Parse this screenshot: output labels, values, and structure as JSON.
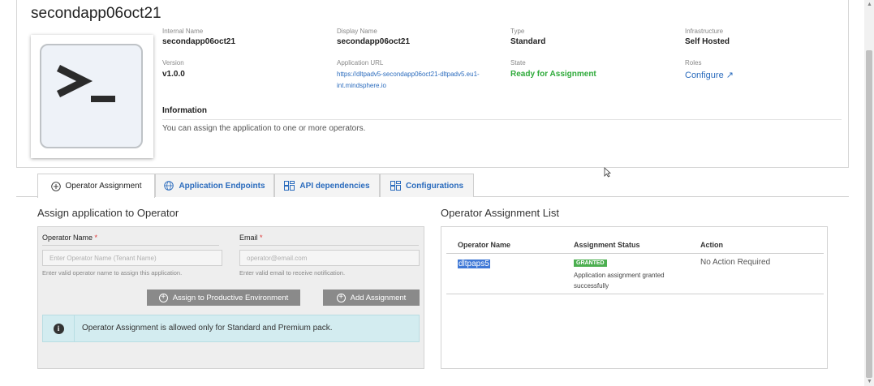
{
  "app": {
    "title": "secondapp06oct21",
    "fields": {
      "internal_name": {
        "label": "Internal Name",
        "value": "secondapp06oct21"
      },
      "display_name": {
        "label": "Display Name",
        "value": "secondapp06oct21"
      },
      "type": {
        "label": "Type",
        "value": "Standard"
      },
      "infrastructure": {
        "label": "Infrastructure",
        "value": "Self Hosted"
      },
      "version": {
        "label": "Version",
        "value": "v1.0.0"
      },
      "app_url": {
        "label": "Application URL",
        "value": "https://dltpadv5-secondapp06oct21-dltpadv5.eu1-int.mindsphere.io"
      },
      "state": {
        "label": "State",
        "value": "Ready for Assignment"
      },
      "roles": {
        "label": "Roles",
        "value": "Configure ↗"
      }
    },
    "information": {
      "label": "Information",
      "text": "You can assign the application to one or more operators."
    },
    "icon": "terminal-prompt-icon"
  },
  "tabs": [
    {
      "label": "Operator Assignment",
      "icon": "plus-circle-icon",
      "active": true
    },
    {
      "label": "Application Endpoints",
      "icon": "globe-icon",
      "active": false
    },
    {
      "label": "API dependencies",
      "icon": "grid-icon",
      "active": false
    },
    {
      "label": "Configurations",
      "icon": "grid-icon",
      "active": false
    }
  ],
  "assign_form": {
    "title": "Assign application to Operator",
    "operator_name": {
      "label": "Operator Name",
      "required": "*",
      "placeholder": "Enter Operator Name (Tenant Name)",
      "hint": "Enter valid operator name to assign this application."
    },
    "email": {
      "label": "Email",
      "required": "*",
      "placeholder": "operator@email.com",
      "hint": "Enter valid email to receive notification."
    },
    "btn_productive": "Assign to Productive Environment",
    "btn_add": "Add Assignment",
    "alert": "Operator Assignment is allowed only for Standard and Premium pack."
  },
  "assignment_list": {
    "title": "Operator Assignment List",
    "columns": [
      "Operator Name",
      "Assignment Status",
      "Action"
    ],
    "rows": [
      {
        "operator": "dltpaps5",
        "badge": "GRANTED",
        "status": "Application assignment granted successfully",
        "action": "No Action Required"
      }
    ]
  },
  "colors": {
    "accent": "#2a6bbd",
    "success": "#2eaa3a",
    "badge": "#4caf50",
    "info_bg": "#d3ecf0"
  }
}
